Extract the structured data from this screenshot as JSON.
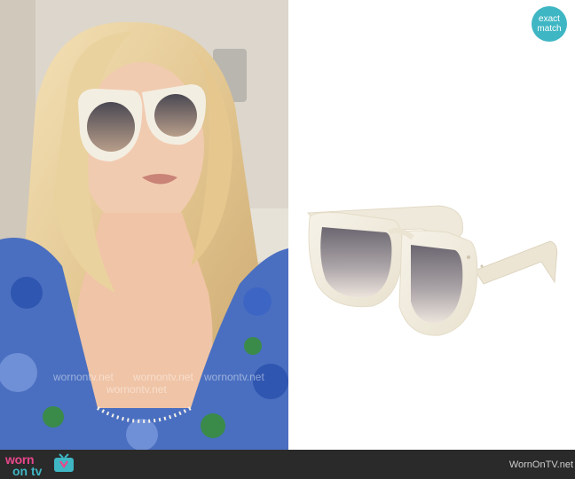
{
  "badge": {
    "line1": "exact",
    "line2": "match"
  },
  "footer": {
    "logo_top": "worn",
    "logo_bottom": "on tv",
    "site_label": "WornOnTV.net"
  },
  "watermarks": [
    "wornontv.net",
    "wornontv.net",
    "wornontv.net",
    "wornontv.net"
  ],
  "colors": {
    "badge": "#3fb6c3",
    "logo_pink": "#e8478b",
    "logo_teal": "#3fb6c3",
    "footer_bg": "#2a2a2a",
    "frame_cream": "#f3eee2"
  },
  "icons": {
    "logo_icon": "tv-icon"
  }
}
